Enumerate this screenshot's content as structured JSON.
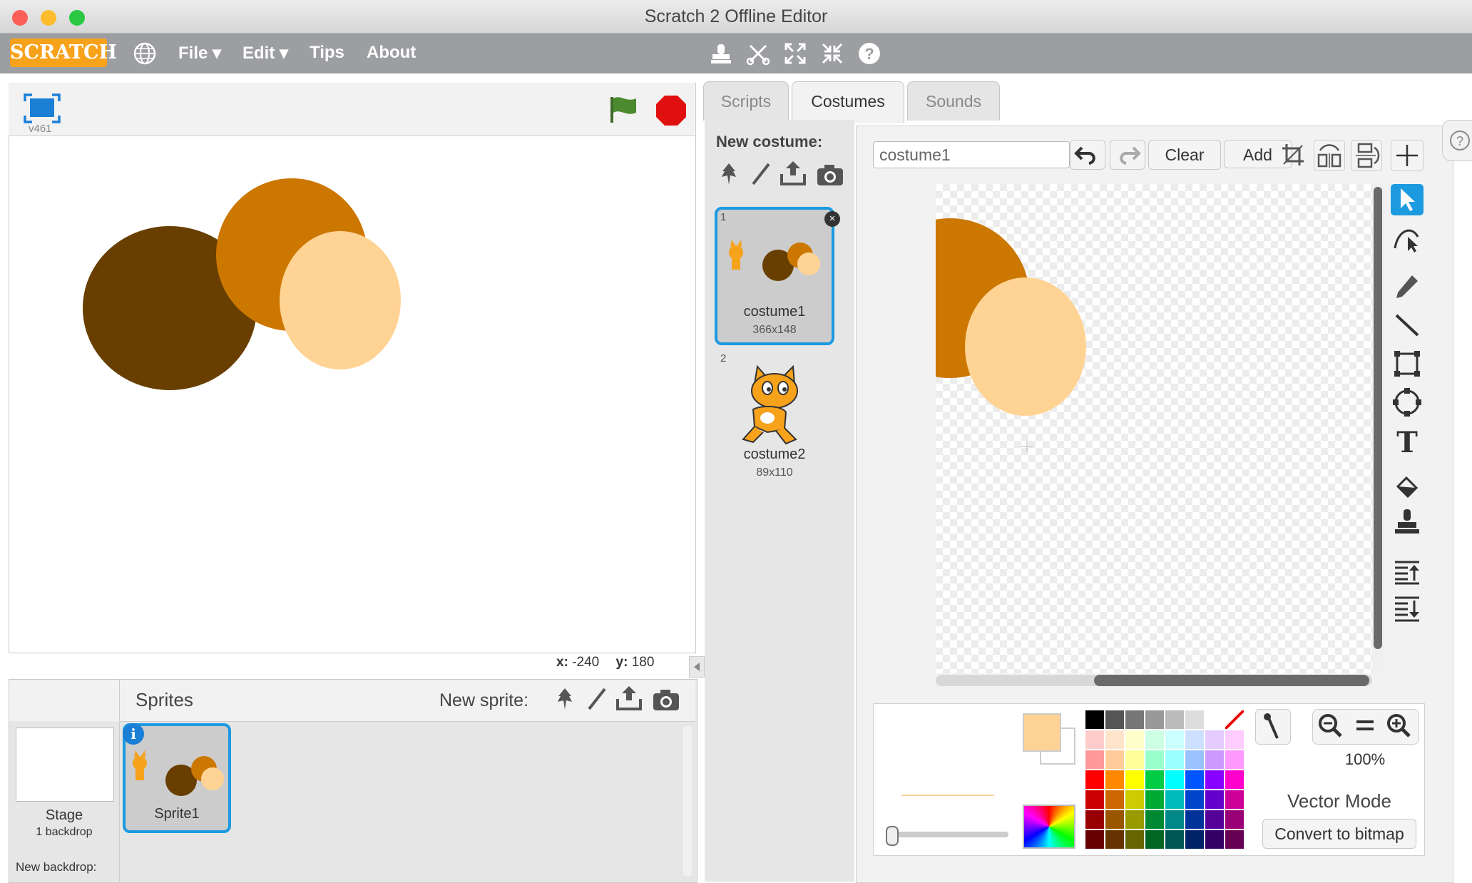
{
  "window": {
    "title": "Scratch 2 Offline Editor"
  },
  "menu": {
    "logo": "SCRATCH",
    "items": [
      {
        "label": "File ▾"
      },
      {
        "label": "Edit ▾"
      },
      {
        "label": "Tips"
      },
      {
        "label": "About"
      }
    ]
  },
  "stage": {
    "version": "v461",
    "coords": {
      "x_label": "x:",
      "x_value": "-240",
      "y_label": "y:",
      "y_value": "180"
    }
  },
  "sprites_pane": {
    "header": "Sprites",
    "new_sprite_label": "New sprite:",
    "stage_tile": {
      "label": "Stage",
      "sublabel": "1 backdrop"
    },
    "new_backdrop_label": "New backdrop:",
    "sprites": [
      {
        "name": "Sprite1"
      }
    ]
  },
  "tabs": [
    {
      "label": "Scripts"
    },
    {
      "label": "Costumes"
    },
    {
      "label": "Sounds"
    }
  ],
  "costumes": {
    "new_costume_label": "New costume:",
    "items": [
      {
        "index": "1",
        "name": "costume1",
        "size": "366x148"
      },
      {
        "index": "2",
        "name": "costume2",
        "size": "89x110"
      }
    ]
  },
  "editor": {
    "costume_name": "costume1",
    "clear_label": "Clear",
    "add_label": "Add",
    "zoom": "100%",
    "mode_label": "Vector Mode",
    "convert_label": "Convert to bitmap",
    "fill_color": "#ffd394"
  },
  "colors": {
    "dark_brown": "#683f00",
    "orange": "#cc7700",
    "peach": "#ffd394",
    "accent_blue": "#1c9ae0"
  }
}
